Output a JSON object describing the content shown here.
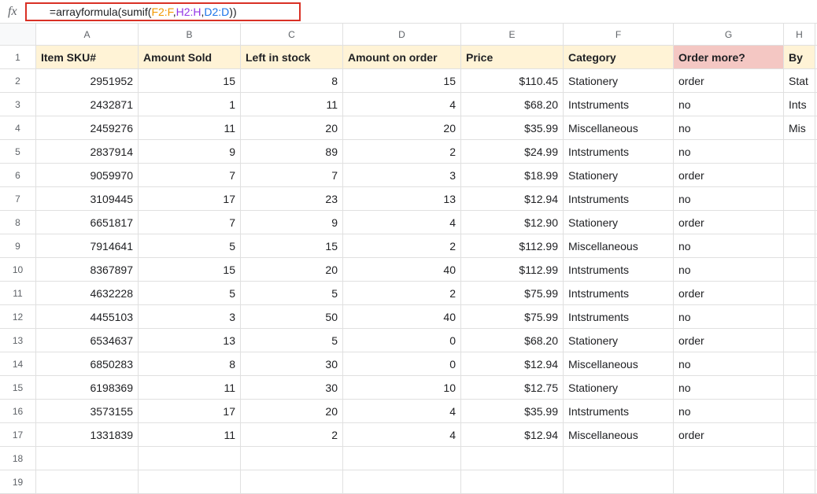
{
  "formula_bar": {
    "fx_label": "fx",
    "formula_prefix": "=arrayformula",
    "paren_open1": "(",
    "fn2": "sumif",
    "paren_open2": "(",
    "range1": "F2:F",
    "comma1": ",",
    "range2": "H2:H",
    "comma2": ",",
    "range3": "D2:D",
    "paren_close": "))"
  },
  "columns": [
    "A",
    "B",
    "C",
    "D",
    "E",
    "F",
    "G",
    "H"
  ],
  "headers": {
    "a": "Item SKU#",
    "b": "Amount Sold",
    "c": "Left  in stock",
    "d": "Amount on order",
    "e": "Price",
    "f": "Category",
    "g": "Order more?",
    "h": "By"
  },
  "rows": [
    {
      "n": "2",
      "a": "2951952",
      "b": "15",
      "c": "8",
      "d": "15",
      "e": "$110.45",
      "f": "Stationery",
      "g": "order",
      "h": "Stat"
    },
    {
      "n": "3",
      "a": "2432871",
      "b": "1",
      "c": "11",
      "d": "4",
      "e": "$68.20",
      "f": "Intstruments",
      "g": "no",
      "h": "Ints"
    },
    {
      "n": "4",
      "a": "2459276",
      "b": "11",
      "c": "20",
      "d": "20",
      "e": "$35.99",
      "f": "Miscellaneous",
      "g": "no",
      "h": "Mis"
    },
    {
      "n": "5",
      "a": "2837914",
      "b": "9",
      "c": "89",
      "d": "2",
      "e": "$24.99",
      "f": "Intstruments",
      "g": "no",
      "h": ""
    },
    {
      "n": "6",
      "a": "9059970",
      "b": "7",
      "c": "7",
      "d": "3",
      "e": "$18.99",
      "f": "Stationery",
      "g": "order",
      "h": ""
    },
    {
      "n": "7",
      "a": "3109445",
      "b": "17",
      "c": "23",
      "d": "13",
      "e": "$12.94",
      "f": "Intstruments",
      "g": "no",
      "h": ""
    },
    {
      "n": "8",
      "a": "6651817",
      "b": "7",
      "c": "9",
      "d": "4",
      "e": "$12.90",
      "f": "Stationery",
      "g": "order",
      "h": ""
    },
    {
      "n": "9",
      "a": "7914641",
      "b": "5",
      "c": "15",
      "d": "2",
      "e": "$112.99",
      "f": "Miscellaneous",
      "g": "no",
      "h": ""
    },
    {
      "n": "10",
      "a": "8367897",
      "b": "15",
      "c": "20",
      "d": "40",
      "e": "$112.99",
      "f": "Intstruments",
      "g": "no",
      "h": ""
    },
    {
      "n": "11",
      "a": "4632228",
      "b": "5",
      "c": "5",
      "d": "2",
      "e": "$75.99",
      "f": "Intstruments",
      "g": "order",
      "h": ""
    },
    {
      "n": "12",
      "a": "4455103",
      "b": "3",
      "c": "50",
      "d": "40",
      "e": "$75.99",
      "f": "Intstruments",
      "g": "no",
      "h": ""
    },
    {
      "n": "13",
      "a": "6534637",
      "b": "13",
      "c": "5",
      "d": "0",
      "e": "$68.20",
      "f": "Stationery",
      "g": "order",
      "h": ""
    },
    {
      "n": "14",
      "a": "6850283",
      "b": "8",
      "c": "30",
      "d": "0",
      "e": "$12.94",
      "f": "Miscellaneous",
      "g": "no",
      "h": ""
    },
    {
      "n": "15",
      "a": "6198369",
      "b": "11",
      "c": "30",
      "d": "10",
      "e": "$12.75",
      "f": "Stationery",
      "g": "no",
      "h": ""
    },
    {
      "n": "16",
      "a": "3573155",
      "b": "17",
      "c": "20",
      "d": "4",
      "e": "$35.99",
      "f": "Intstruments",
      "g": "no",
      "h": ""
    },
    {
      "n": "17",
      "a": "1331839",
      "b": "11",
      "c": "2",
      "d": "4",
      "e": "$12.94",
      "f": "Miscellaneous",
      "g": "order",
      "h": ""
    }
  ],
  "empty_rows": [
    "18",
    "19"
  ]
}
